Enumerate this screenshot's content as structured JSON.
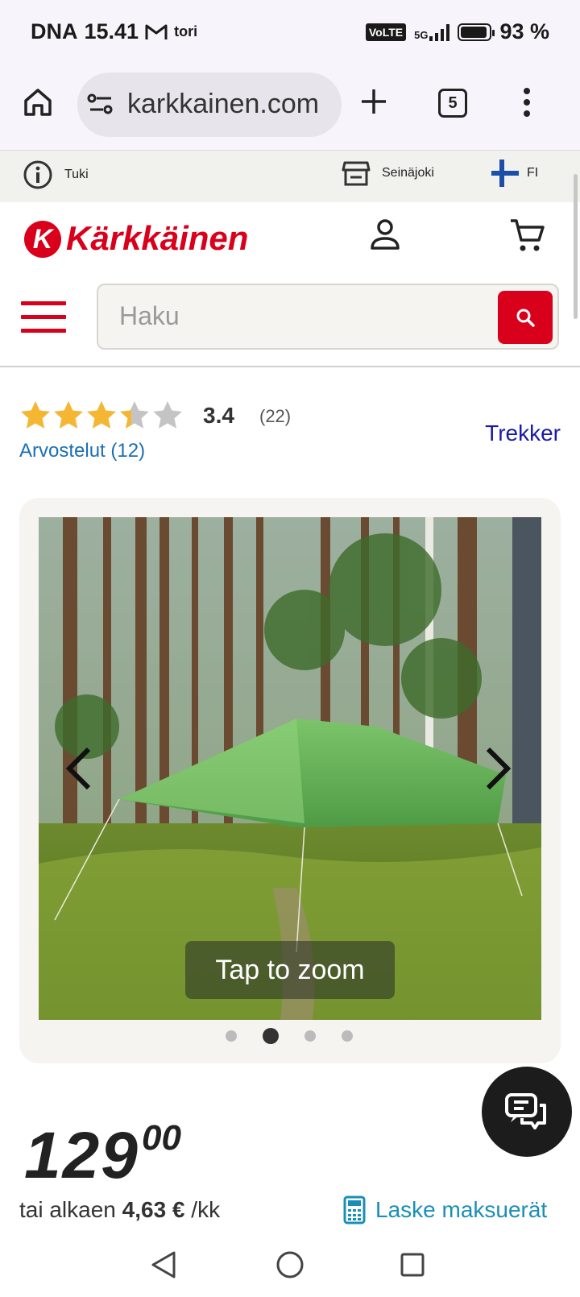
{
  "status_bar": {
    "carrier": "DNA",
    "time": "15.41",
    "app_label": "tori",
    "volte": "VoLTE",
    "network": "5G",
    "battery": "93 %",
    "battery_level": 0.93
  },
  "browser": {
    "url": "karkkainen.com",
    "tab_count": "5"
  },
  "info_strip": {
    "support_label": "Tuki",
    "store_label": "Seinäjoki",
    "language": "FI"
  },
  "header": {
    "logo_text": "Kärkkäinen",
    "search_placeholder": "Haku"
  },
  "product": {
    "rating": "3.4",
    "rating_score": 3.4,
    "rating_count": "(22)",
    "reviews_link": "Arvostelut (12)",
    "brand": "Trekker",
    "zoom_hint": "Tap to zoom",
    "gallery_total": 4,
    "gallery_active": 1,
    "price_main": "129",
    "price_cents": "00",
    "installment_prefix": "tai alkaen",
    "installment_amount": "4,63 €",
    "installment_suffix": "/kk",
    "installment_link": "Laske maksuerät"
  },
  "colors": {
    "brand_red": "#d9001b",
    "star_gold": "#f5b731",
    "link_blue": "#1a6fb5"
  }
}
